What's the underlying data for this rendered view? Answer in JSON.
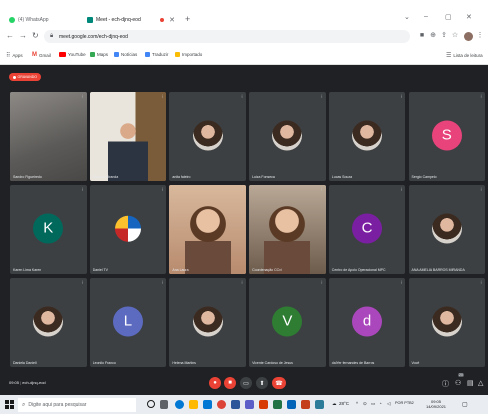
{
  "browser": {
    "tabs": [
      {
        "title": "(4) WhatsApp",
        "fav_color": "#25d366"
      },
      {
        "title": "Meet - ech-djnq-eod",
        "fav_color": "#00897b"
      }
    ],
    "new_tab": "+",
    "window_controls": {
      "chevron": "⌄",
      "minimize": "–",
      "maximize": "▢",
      "close": "✕"
    },
    "url": "meet.google.com/ech-djnq-eod",
    "bookmarks": [
      {
        "label": "Apps",
        "color": "#5f6368"
      },
      {
        "label": "Gmail",
        "color": "#ea4335"
      },
      {
        "label": "YouTube",
        "color": "#ff0000"
      },
      {
        "label": "Maps",
        "color": "#34a853"
      },
      {
        "label": "Notícias",
        "color": "#4285f4"
      },
      {
        "label": "Traduzir",
        "color": "#4285f4"
      },
      {
        "label": "Importado",
        "color": "#fbbc04"
      }
    ],
    "reading_list": "Lista de leitura"
  },
  "meet": {
    "recording_label": "GRAVANDO",
    "meeting_time": "09:05",
    "meeting_code": "ech-djnq-eod",
    "participants": [
      {
        "name": "Sandro Figueiredo",
        "kind": "video",
        "bg": "#6b6a68"
      },
      {
        "name": "Claudio Miranda",
        "kind": "video",
        "bg": "#7a6a55"
      },
      {
        "name": "anita faleiro",
        "kind": "photo",
        "bg": "#3c4043"
      },
      {
        "name": "Luiza Fonseca",
        "kind": "photo",
        "bg": "#3c4043"
      },
      {
        "name": "Lucas Souza",
        "kind": "photo",
        "bg": "#3c4043"
      },
      {
        "name": "Sergio Campelo",
        "kind": "letter",
        "letter": "S",
        "color": "#e8437a"
      },
      {
        "name": "Karen Lima Karen",
        "kind": "letter",
        "letter": "K",
        "color": "#00695c"
      },
      {
        "name": "Daniel TV",
        "kind": "logo",
        "bg": "#3c4043"
      },
      {
        "name": "Ana Laura",
        "kind": "video",
        "bg": "#c9a082"
      },
      {
        "name": "Coordenação CCvi",
        "kind": "video",
        "bg": "#8e7f70"
      },
      {
        "name": "Centro de Apoio Operacional MPC",
        "kind": "letter",
        "letter": "C",
        "color": "#7b1fa2"
      },
      {
        "name": "ANA AMELIA BARROS MIRANDA",
        "kind": "photo",
        "bg": "#3c4043"
      },
      {
        "name": "Daniela Daniell",
        "kind": "photo",
        "bg": "#3c4043"
      },
      {
        "name": "Leonilo Franco",
        "kind": "letter",
        "letter": "L",
        "color": "#5c6bc0"
      },
      {
        "name": "Helena Martins",
        "kind": "photo",
        "bg": "#3c4043"
      },
      {
        "name": "Vicente Cardoso de Jesus",
        "kind": "letter",
        "letter": "V",
        "color": "#2e7d32"
      },
      {
        "name": "daiYer fernandes de Barros",
        "kind": "letter",
        "letter": "d",
        "color": "#ab47bc"
      },
      {
        "name": "Você",
        "kind": "photo",
        "bg": "#3c4043"
      }
    ],
    "people_count": "20"
  },
  "taskbar": {
    "search_placeholder": "Digite aqui para pesquisar",
    "weather": "28°C",
    "language": "POR PTB2",
    "time": "09:05",
    "date": "14/09/2021"
  },
  "colors": {
    "meet_bg": "#202124",
    "tile_bg": "#3c4043",
    "red": "#ea4335"
  }
}
